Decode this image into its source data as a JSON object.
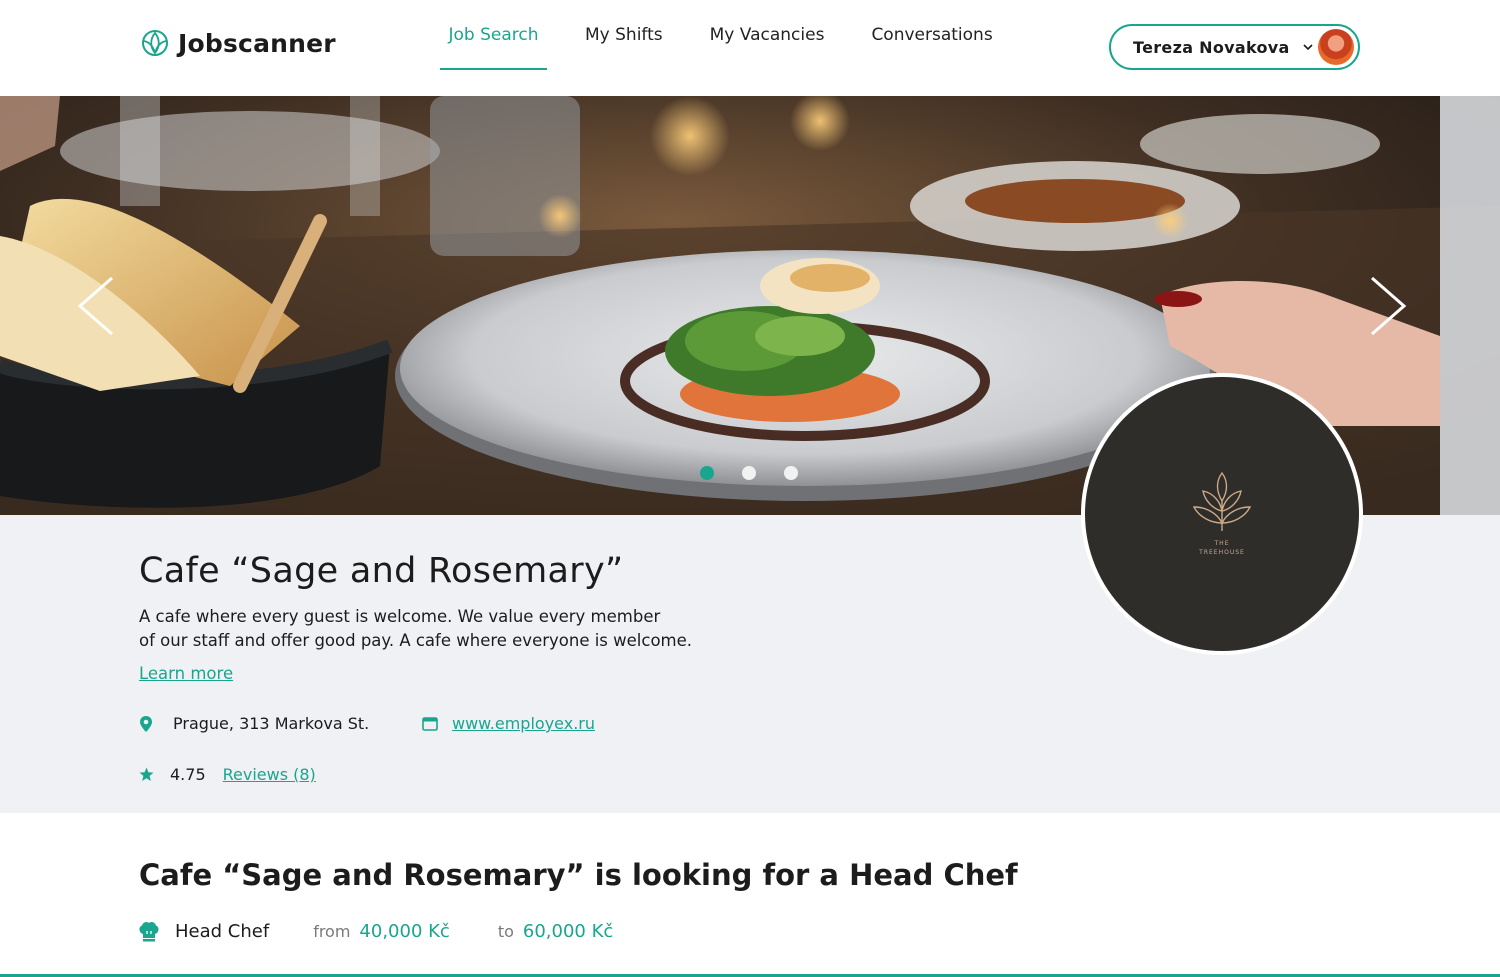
{
  "header": {
    "brand": "Jobscanner",
    "nav": [
      {
        "label": "Job Search",
        "active": true
      },
      {
        "label": "My Shifts",
        "active": false
      },
      {
        "label": "My Vacancies",
        "active": false
      },
      {
        "label": "Conversations",
        "active": false
      }
    ],
    "user": {
      "name": "Tereza Novakova"
    }
  },
  "hero": {
    "slides": 3,
    "active_slide": 1
  },
  "cafe": {
    "title": "Cafe “Sage and Rosemary”",
    "description_line1": "A cafe where every guest is welcome. We value every member",
    "description_line2": "of our staff and offer good pay. A cafe where everyone is welcome.",
    "learn_more": "Learn more",
    "address": "Prague, 313 Markova St.",
    "website": "www.employex.ru",
    "rating": "4.75",
    "reviews": "Reviews (8)",
    "logo_text_top": "THE",
    "logo_text_bottom": "TREEHOUSE"
  },
  "vacancy": {
    "title": "Cafe “Sage and Rosemary” is looking for a Head Chef",
    "role": "Head Chef",
    "from_label": "from",
    "from_amount": "40,000 Kč",
    "to_label": "to",
    "to_amount": "60,000 Kč"
  },
  "colors": {
    "accent": "#1aa58e",
    "info_bg": "#f0f1f5",
    "logo_bg": "#2f2d2a"
  }
}
